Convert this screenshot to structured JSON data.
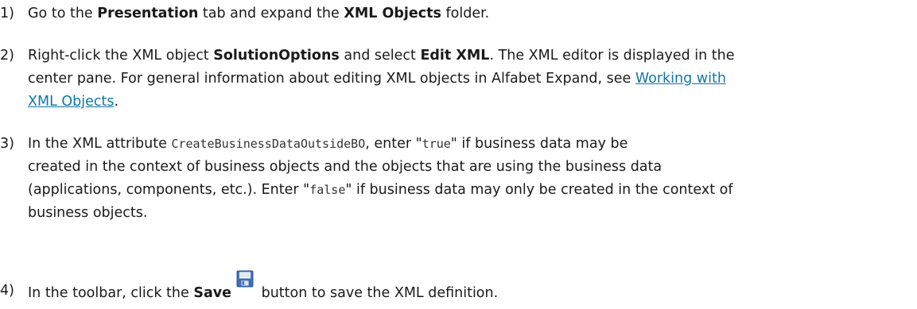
{
  "steps": [
    {
      "number": "1)",
      "t1": "Go to the ",
      "b1": "Presentation",
      "t2": " tab and expand the ",
      "b2": "XML Objects",
      "t3": " folder."
    },
    {
      "number": "2)",
      "t1": "Right-click the XML object ",
      "b1": "SolutionOptions",
      "t2": " and select ",
      "b2": "Edit XML",
      "t3": ". The XML editor is displayed in the",
      "line2": "center pane. For general information about editing XML objects in Alfabet Expand, see ",
      "link_part1": "Working with ",
      "link_part2": "XML Objects",
      "t4": "."
    },
    {
      "number": "3)",
      "t1": "In the XML attribute ",
      "code1": "CreateBusinessDataOutsideBO",
      "t2": ", enter \"",
      "code2": "true",
      "t3": "\" if business data may be",
      "line2": "created in the context of business objects and the objects that are using the business data",
      "line3a": "(applications, components, etc.). Enter \"",
      "code3": "false",
      "line3b": "\" if business data may only be created in the context of",
      "line4": "business objects."
    },
    {
      "number": "4)",
      "t1": "In the toolbar, click the ",
      "b1": "Save",
      "icon": "save-icon",
      "t2": " button to save the XML definition."
    }
  ],
  "colors": {
    "text": "#1a1a1a",
    "link": "#1178a6",
    "save_icon_blue": "#3d6fb6"
  }
}
